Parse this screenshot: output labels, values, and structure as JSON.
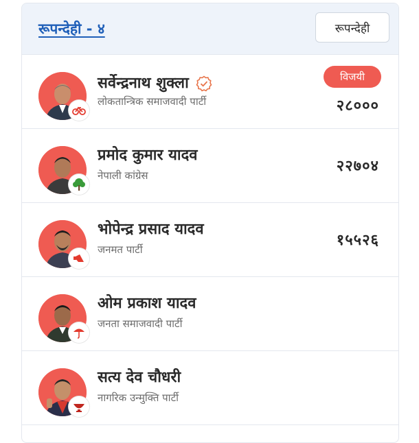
{
  "header": {
    "constituency": "रूपन्देही - ४",
    "district_button": "रूपन्देही"
  },
  "candidates": [
    {
      "name": "सर्वेन्द्रनाथ शुक्ला",
      "party": "लोकतान्त्रिक समाजवादी पार्टी",
      "votes": "२८०००",
      "status_badge": "विजयी",
      "verified": true,
      "symbol_icon": "bicycle-icon"
    },
    {
      "name": "प्रमोद कुमार यादव",
      "party": "नेपाली कांग्रेस",
      "votes": "२२७०४",
      "symbol_icon": "tree-icon"
    },
    {
      "name": "भोपेन्द्र प्रसाद यादव",
      "party": "जनमत पार्टी",
      "votes": "१५५२६",
      "symbol_icon": "megaphone-icon"
    },
    {
      "name": "ओम प्रकाश यादव",
      "party": "जनता समाजवादी पार्टी",
      "votes": "",
      "symbol_icon": "umbrella-icon"
    },
    {
      "name": "सत्य देव चौधरी",
      "party": "नागरिक उन्मुक्ति पार्टी",
      "votes": "",
      "symbol_icon": "bowl-icon"
    }
  ],
  "colors": {
    "accent_red": "#ef5b52",
    "link_blue": "#1f5fb8",
    "header_bg": "#eef3fa"
  }
}
